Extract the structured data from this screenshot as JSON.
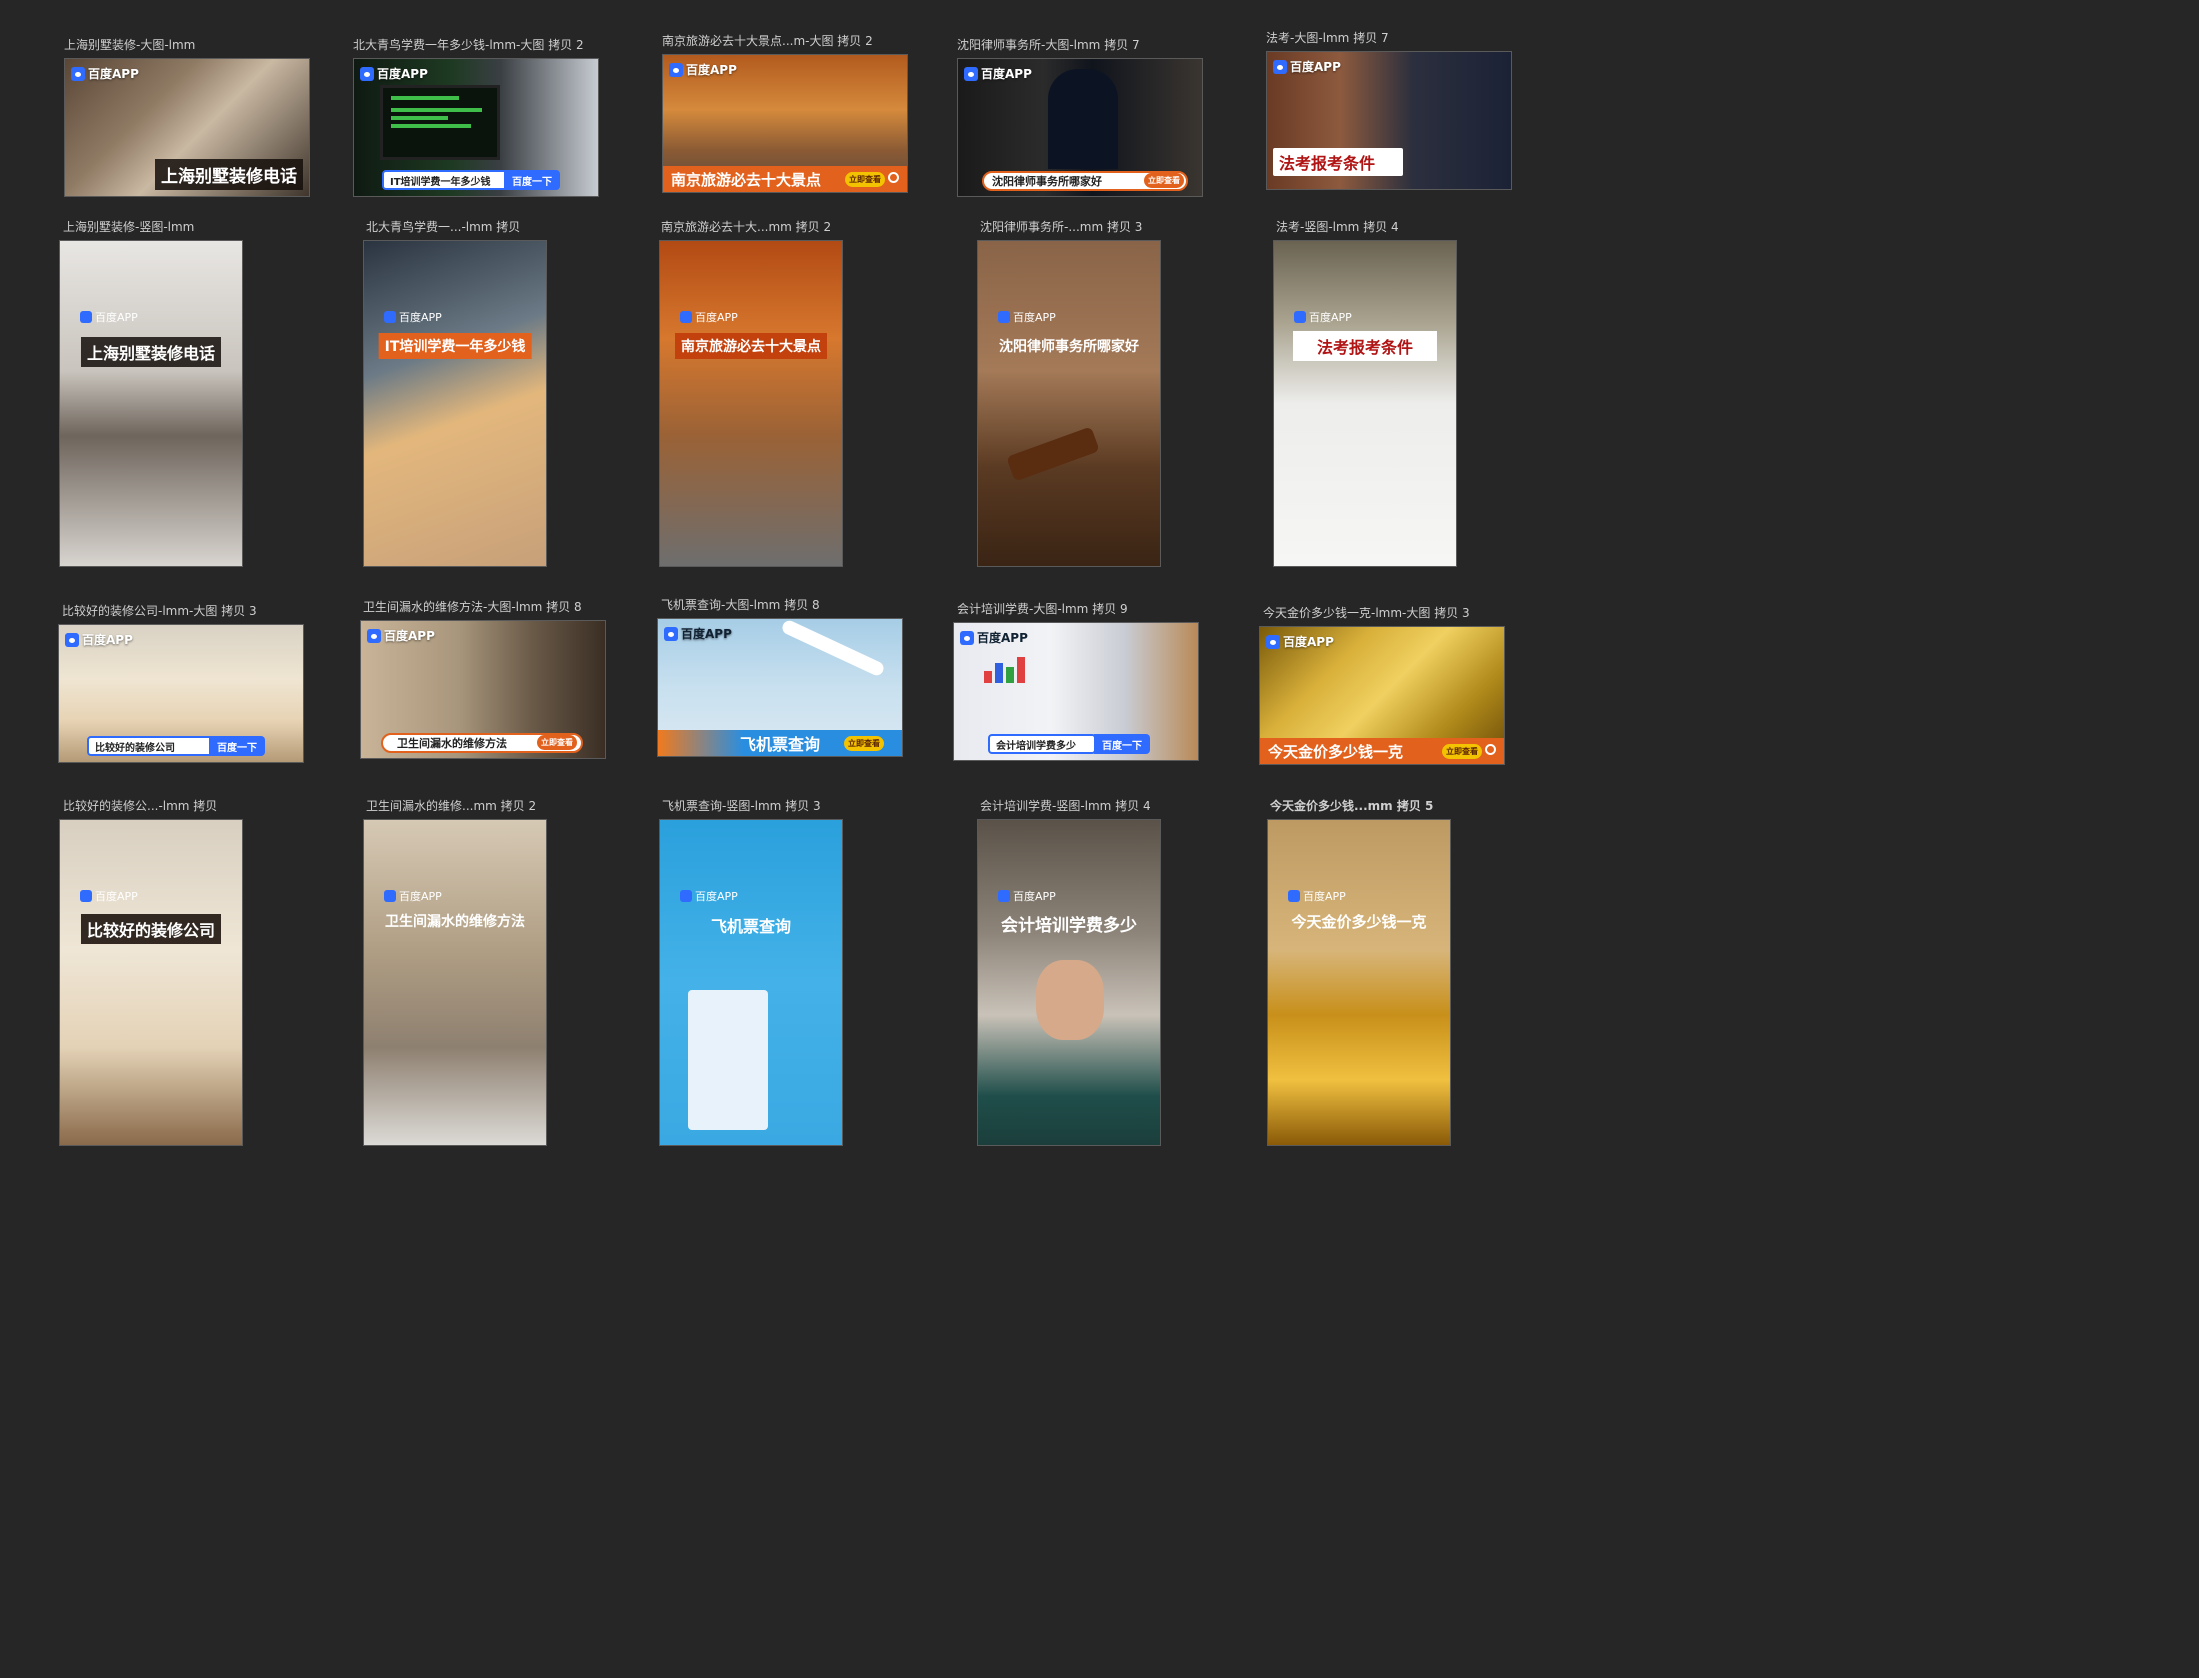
{
  "logo_text": "百度APP",
  "cta_label": "立即查看",
  "search_button": "百度一下",
  "artboards": [
    {
      "name": "上海别墅装修-大图-lmm",
      "headline": "上海别墅装修电话"
    },
    {
      "name": "北大青鸟学费一年多少钱-lmm-大图 拷贝 2",
      "headline": "IT培训学费一年多少钱"
    },
    {
      "name": "南京旅游必去十大景点...m-大图 拷贝 2",
      "headline": "南京旅游必去十大景点"
    },
    {
      "name": "沈阳律师事务所-大图-lmm 拷贝 7",
      "headline": "沈阳律师事务所哪家好"
    },
    {
      "name": "法考-大图-lmm 拷贝 7",
      "headline": "法考报考条件"
    },
    {
      "name": "上海别墅装修-竖图-lmm",
      "headline": "上海别墅装修电话"
    },
    {
      "name": "北大青鸟学费一...-lmm 拷贝",
      "headline": "IT培训学费一年多少钱"
    },
    {
      "name": "南京旅游必去十大...mm 拷贝 2",
      "headline": "南京旅游必去十大景点"
    },
    {
      "name": "沈阳律师事务所-...mm 拷贝 3",
      "headline": "沈阳律师事务所哪家好"
    },
    {
      "name": "法考-竖图-lmm 拷贝 4",
      "headline": "法考报考条件"
    },
    {
      "name": "比较好的装修公司-lmm-大图 拷贝 3",
      "headline": "比较好的装修公司"
    },
    {
      "name": "卫生间漏水的维修方法-大图-lmm 拷贝 8",
      "headline": "卫生间漏水的维修方法"
    },
    {
      "name": "飞机票查询-大图-lmm 拷贝 8",
      "headline": "飞机票查询"
    },
    {
      "name": "会计培训学费-大图-lmm 拷贝 9",
      "headline": "会计培训学费多少"
    },
    {
      "name": "今天金价多少钱一克-lmm-大图 拷贝 3",
      "headline": "今天金价多少钱一克"
    },
    {
      "name": "比较好的装修公...-lmm 拷贝",
      "headline": "比较好的装修公司"
    },
    {
      "name": "卫生间漏水的维修...mm 拷贝 2",
      "headline": "卫生间漏水的维修方法"
    },
    {
      "name": "飞机票查询-竖图-lmm 拷贝 3",
      "headline": "飞机票查询"
    },
    {
      "name": "会计培训学费-竖图-lmm 拷贝 4",
      "headline": "会计培训学费多少"
    },
    {
      "name": "今天金价多少钱...mm 拷贝 5",
      "headline": "今天金价多少钱一克"
    }
  ],
  "colors": {
    "canvas_bg": "#262626",
    "baidu_blue": "#2f6bff",
    "cta_yellow": "#f3c200",
    "orange_bar": "#e2611c",
    "red_text": "#b01414"
  }
}
